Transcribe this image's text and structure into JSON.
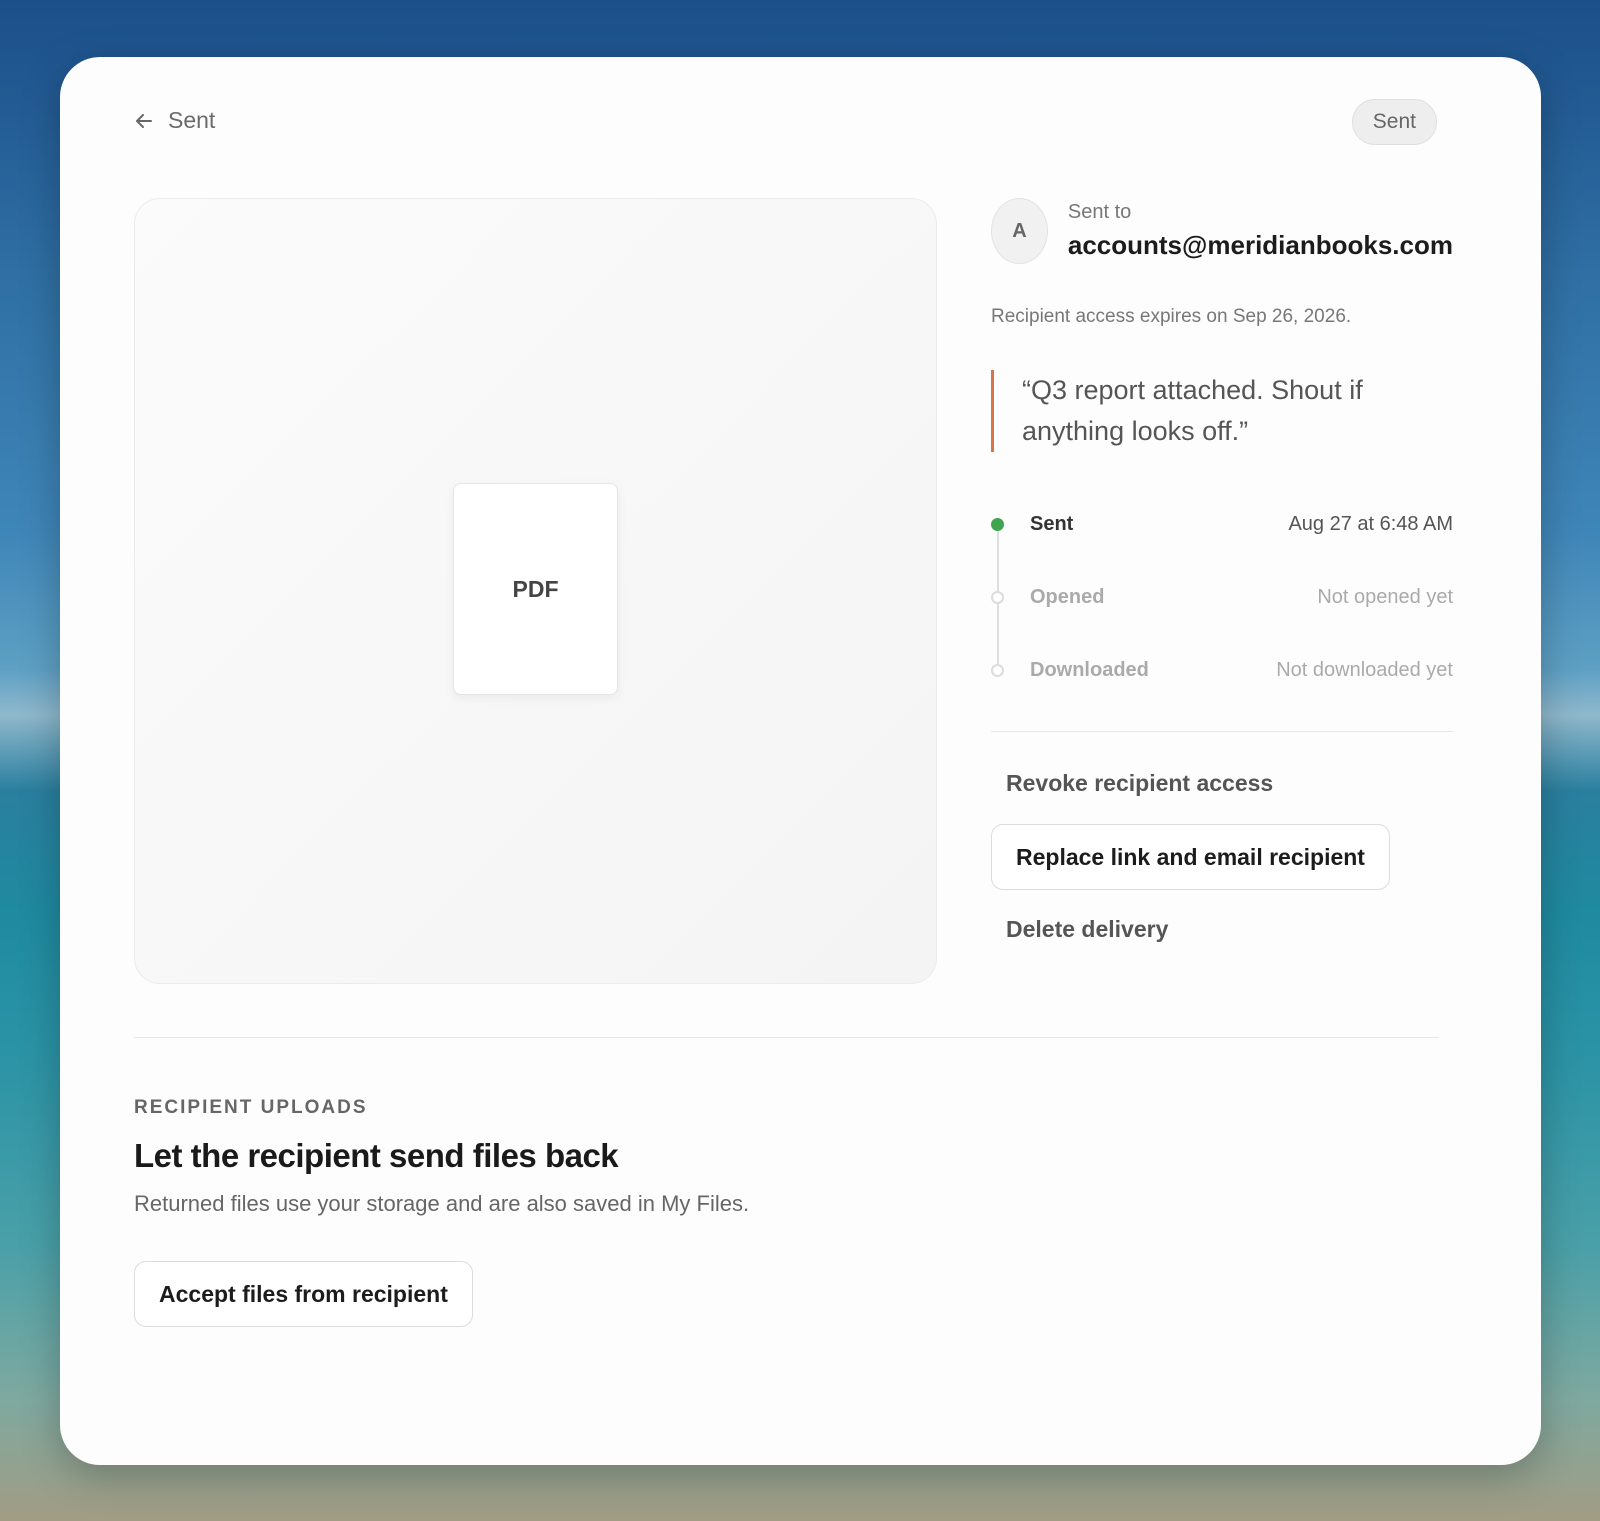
{
  "header": {
    "back_label": "Sent",
    "status_badge": "Sent"
  },
  "preview": {
    "file_type": "PDF"
  },
  "recipient": {
    "avatar_initial": "A",
    "label": "Sent to",
    "email": "accounts@meridianbooks.com",
    "expires_text": "Recipient access expires on Sep 26, 2026.",
    "message": "“Q3 report attached. Shout if anything looks off.”"
  },
  "timeline": [
    {
      "label": "Sent",
      "time": "Aug 27 at 6:48 AM",
      "active": true
    },
    {
      "label": "Opened",
      "time": "Not opened yet",
      "active": false
    },
    {
      "label": "Downloaded",
      "time": "Not downloaded yet",
      "active": false
    }
  ],
  "actions": {
    "revoke": "Revoke recipient access",
    "replace": "Replace link and email recipient",
    "delete": "Delete delivery"
  },
  "uploads": {
    "eyebrow": "RECIPIENT UPLOADS",
    "title": "Let the recipient send files back",
    "description": "Returned files use your storage and are also saved in My Files.",
    "button": "Accept files from recipient"
  },
  "colors": {
    "accent_quote": "#d9734a",
    "status_sent_dot": "#3fa54e"
  }
}
